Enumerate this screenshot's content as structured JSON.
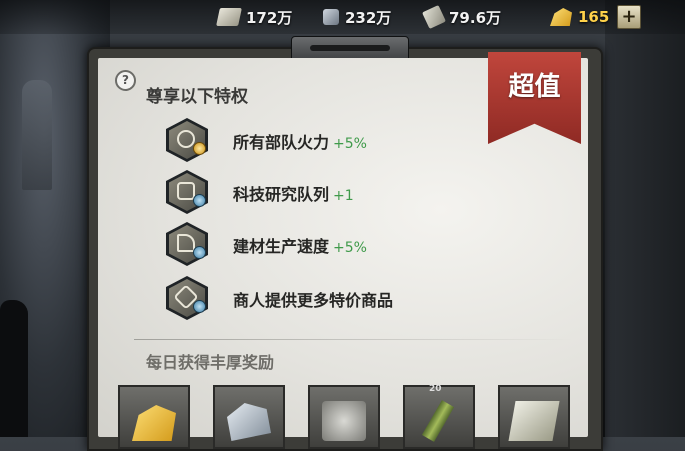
{
  "resources": [
    {
      "icon": "cash-icon",
      "value": "172万"
    },
    {
      "icon": "steel-icon",
      "value": "232万"
    },
    {
      "icon": "bond-icon",
      "value": "79.6万"
    },
    {
      "icon": "gold-icon",
      "value": "165"
    }
  ],
  "plus_label": "+",
  "panel": {
    "help_label": "?",
    "privileges_title": "尊享以下特权",
    "badge": "超值",
    "perks": [
      {
        "icon": "firepower-icon",
        "text": "所有部队火力",
        "bonus": "+5%"
      },
      {
        "icon": "research-icon",
        "text": "科技研究队列",
        "bonus": "+1"
      },
      {
        "icon": "construction-icon",
        "text": "建材生产速度",
        "bonus": "+5%"
      },
      {
        "icon": "merchant-icon",
        "text": "商人提供更多特价商品",
        "bonus": ""
      }
    ],
    "daily_title": "每日获得丰厚奖励",
    "rewards": [
      {
        "icon": "gold-bars-icon",
        "count": ""
      },
      {
        "icon": "steel-ore-icon",
        "count": ""
      },
      {
        "icon": "token-icon",
        "count": ""
      },
      {
        "icon": "green-rod-icon",
        "count": "20"
      },
      {
        "icon": "cash-bundle-icon",
        "count": ""
      }
    ]
  },
  "colors": {
    "ribbon": "#b03a32",
    "bonus": "#3f9a4a",
    "gold": "#ffd24a"
  }
}
